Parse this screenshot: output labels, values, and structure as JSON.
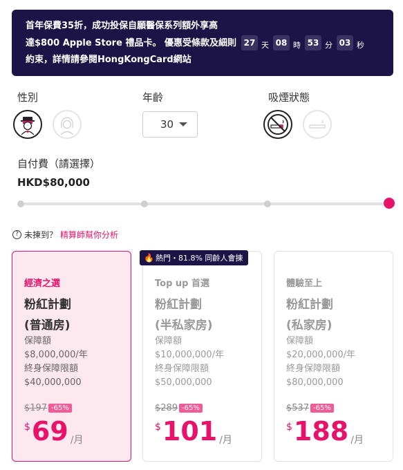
{
  "banner": {
    "text_line1": "首年保費35折，成功投保自願醫保系列額外享高",
    "text_line2": "達$800 Apple Store 禮品卡。 優惠受條款及細則",
    "text_line3": "約束，詳情請參閱HongKongCard網站",
    "countdown": [
      {
        "value": "27",
        "unit": "天"
      },
      {
        "value": "08",
        "unit": "時"
      },
      {
        "value": "53",
        "unit": "分"
      },
      {
        "value": "03",
        "unit": "秒"
      }
    ]
  },
  "filters": {
    "gender_label": "性別",
    "age_label": "年齡",
    "age_value": "30",
    "smoking_label": "吸煙狀態"
  },
  "self_pay": {
    "label": "自付費（請選擇）",
    "amount": "HKD$80,000",
    "selected_step": 4,
    "step_count": 4
  },
  "hint": {
    "text": "未揀到？",
    "link": "精算師幫你分析"
  },
  "hot_badge": "熱門・81.8% 同齡人會揀",
  "plans": [
    {
      "tag": "經濟之選",
      "name": "粉紅計劃",
      "room": "(普通房)",
      "cover_label": "保障額",
      "cover": "$8,000,000/年",
      "lifetime_label": "終身保障限額",
      "lifetime": "$40,000,000",
      "old_price": "$197",
      "discount": "-65%",
      "currency": "$",
      "price": "69",
      "per": "/月"
    },
    {
      "tag": "Top up 首選",
      "name": "粉紅計劃",
      "room": "(半私家房)",
      "cover_label": "保障額",
      "cover": "$10,000,000/年",
      "lifetime_label": "終身保障限額",
      "lifetime": "$50,000,000",
      "old_price": "$289",
      "discount": "-65%",
      "currency": "$",
      "price": "101",
      "per": "/月"
    },
    {
      "tag": "體驗至上",
      "name": "粉紅計劃",
      "room": "(私家房)",
      "cover_label": "保障額",
      "cover": "$20,000,000/年",
      "lifetime_label": "終身保障限額",
      "lifetime": "$80,000,000",
      "old_price": "$537",
      "discount": "-65%",
      "currency": "$",
      "price": "188",
      "per": "/月"
    }
  ],
  "colors": {
    "accent": "#e8126b",
    "banner_bg": "#1c1446",
    "discount_bg": "#f05c96"
  }
}
